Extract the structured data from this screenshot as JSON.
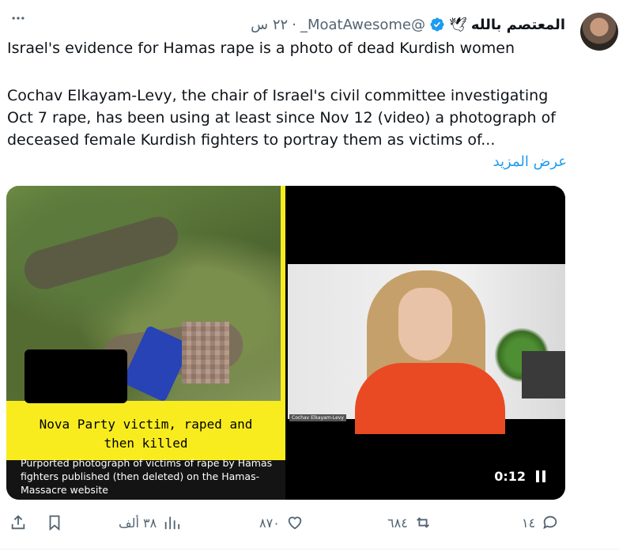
{
  "author": {
    "display_name": "المعتصم بالله",
    "emoji": "🕊",
    "handle": "@MoatAwesome_",
    "dot": "·",
    "time": "٢٢ س"
  },
  "post": {
    "title": "Israel's evidence for Hamas rape is a photo of dead Kurdish women",
    "body": "Cochav Elkayam-Levy, the chair of Israel's civil committee investigating Oct 7 rape, has been using at least since Nov 12 (video) a photograph of deceased female Kurdish fighters to portray them as victims of...",
    "show_more": "عرض المزيد"
  },
  "media": {
    "left": {
      "caption_line1": "Nova Party victim, raped and",
      "caption_line2": "then killed",
      "credit": "Purported photograph of victims of rape by Hamas fighters published (then deleted) on the Hamas-Massacre website"
    },
    "right": {
      "name_tag": "Cochav Elkayam-Levy",
      "video_time": "0:12"
    }
  },
  "actions": {
    "replies": "١٤",
    "reposts": "٦٨٤",
    "likes": "٨٧٠",
    "views": "٣٨ ألف"
  },
  "colors": {
    "accent": "#1d9bf0",
    "muted": "#536471",
    "caption_bg": "#f8ec1f"
  }
}
